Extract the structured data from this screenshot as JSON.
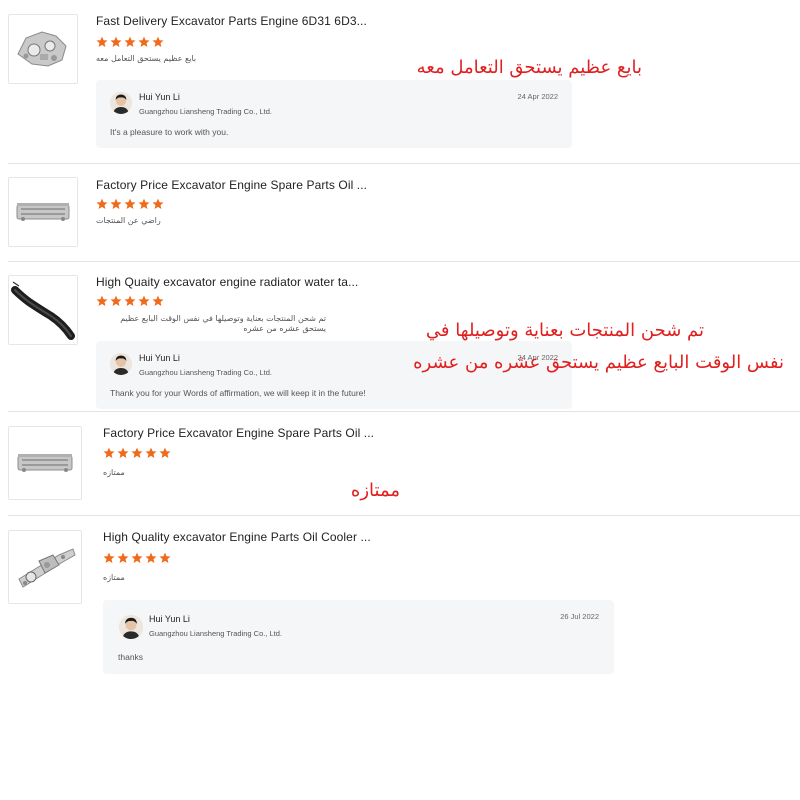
{
  "colors": {
    "star": "#f06a1c",
    "overlay_text": "#e02020",
    "reply_bg": "#f5f6f7",
    "divider": "#e3e3e3"
  },
  "reviews": [
    {
      "product_title": "Fast Delivery Excavator Parts Engine 6D31 6D3...",
      "rating": 5,
      "comment": "بايع عظيم يستحق التعامل معه",
      "thumbnail_icon": "engine-part-icon",
      "reply": {
        "name": "Hui Yun Li",
        "company": "Guangzhou Liansheng Trading Co., Ltd.",
        "date": "24 Apr 2022",
        "text": "It's a pleasure to work with you."
      }
    },
    {
      "product_title": "Factory Price Excavator Engine Spare Parts Oil ...",
      "rating": 5,
      "comment": "راضي عن المنتجات",
      "thumbnail_icon": "oil-cooler-icon"
    },
    {
      "product_title": "High Quaity excavator engine radiator water ta...",
      "rating": 5,
      "comment": "تم شحن المنتجات بعناية وتوصيلها في نفس الوقت البايع عظيم يستحق عشره من عشره",
      "thumbnail_icon": "radiator-hose-icon",
      "reply": {
        "name": "Hui Yun Li",
        "company": "Guangzhou Liansheng Trading Co., Ltd.",
        "date": "24 Apr 2022",
        "text": "Thank you for your Words of affirmation, we will keep it in the future!"
      }
    },
    {
      "product_title": "Factory Price Excavator Engine Spare Parts Oil ...",
      "rating": 5,
      "comment": "ممتازه",
      "thumbnail_icon": "oil-cooler-icon"
    },
    {
      "product_title": "High Quality excavator Engine Parts Oil Cooler ...",
      "rating": 5,
      "comment": "ممتازه",
      "thumbnail_icon": "oil-cooler-assembly-icon",
      "reply": {
        "name": "Hui Yun Li",
        "company": "Guangzhou Liansheng Trading Co., Ltd.",
        "date": "26 Jul 2022",
        "text": "thanks"
      }
    }
  ],
  "overlays": {
    "review1": "بايع عظيم يستحق التعامل معه",
    "review3_line1": "تم شحن المنتجات بعناية وتوصيلها في",
    "review3_line2": "نفس الوقت البايع عظيم يستحق عشره من عشره",
    "review4": "ممتازه"
  }
}
